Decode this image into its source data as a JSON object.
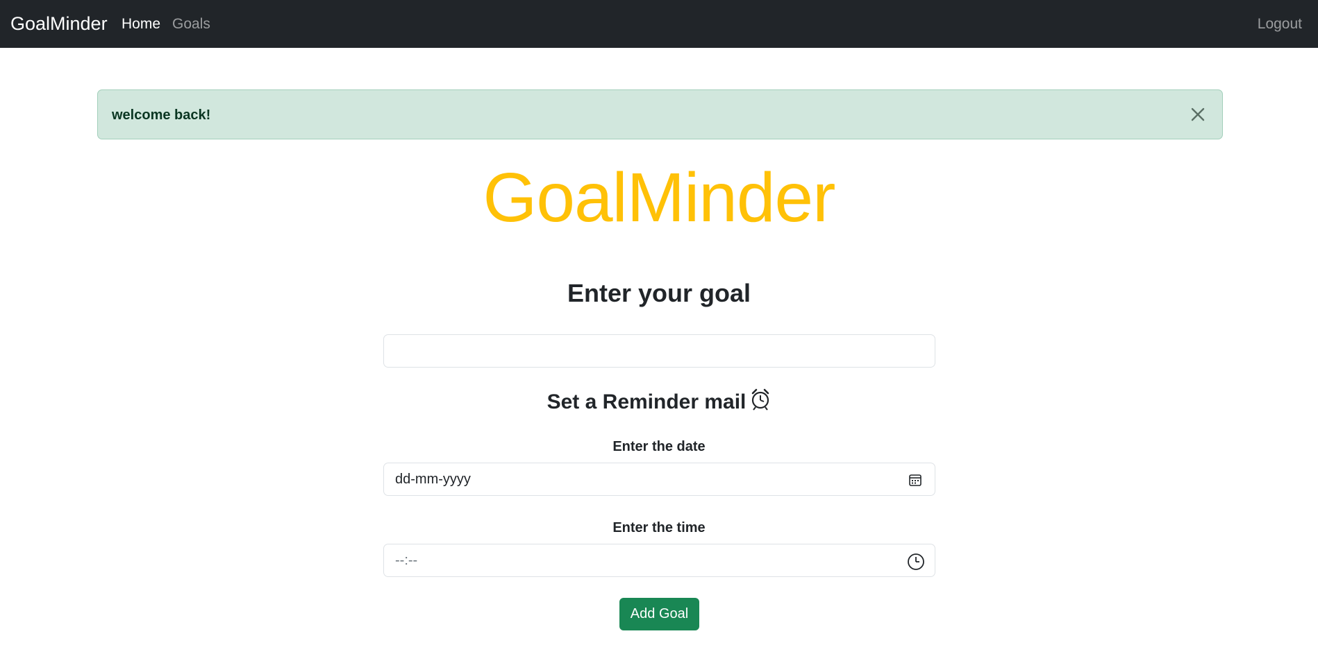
{
  "navbar": {
    "brand": "GoalMinder",
    "links": [
      "Home",
      "Goals"
    ],
    "logout": "Logout"
  },
  "alert": {
    "message": "welcome back!",
    "close_icon": "close-icon"
  },
  "hero": {
    "title": "GoalMinder"
  },
  "form": {
    "goal_heading": "Enter your goal",
    "goal_value": "",
    "reminder_heading": "Set a Reminder mail",
    "reminder_icon": "alarm-clock-icon",
    "date_label": "Enter the date",
    "date_placeholder": "dd-mm-yyyy",
    "date_icon": "calendar-icon",
    "time_label": "Enter the time",
    "time_placeholder": "--:--",
    "time_icon": "clock-icon",
    "submit_label": "Add Goal"
  },
  "colors": {
    "navbar_bg": "#212529",
    "alert_bg": "#d1e7dd",
    "alert_text": "#0a3622",
    "hero": "#ffc107",
    "button": "#198754"
  }
}
